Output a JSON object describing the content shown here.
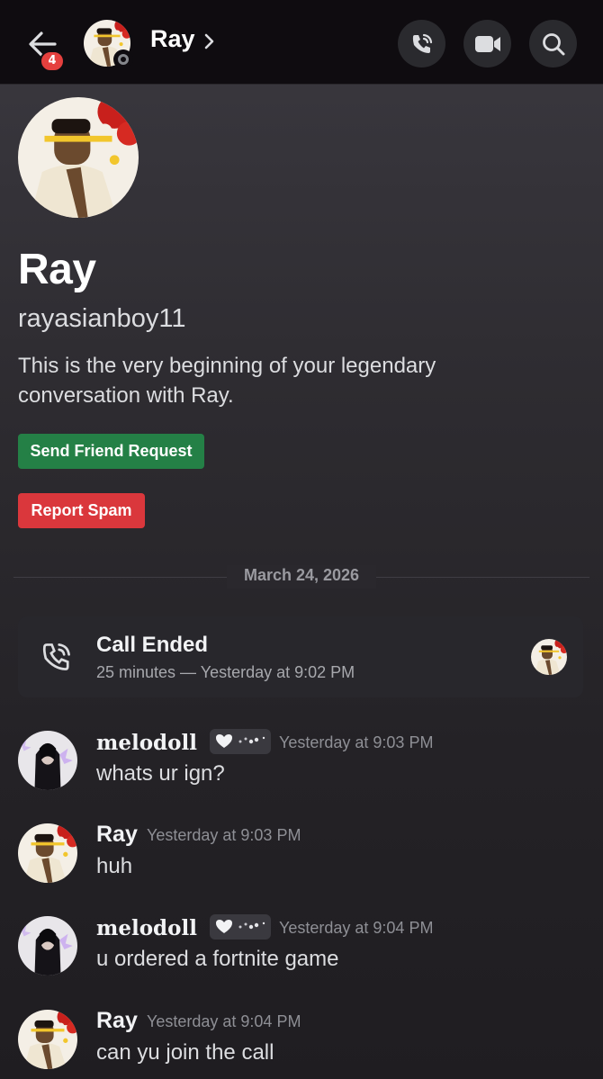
{
  "header": {
    "name": "Ray",
    "badge_count": "4",
    "icons": {
      "back": "arrow-left-icon",
      "chevron": "chevron-right-icon",
      "call": "phone-call-icon",
      "video": "video-camera-icon",
      "search": "search-icon"
    }
  },
  "profile": {
    "display_name": "Ray",
    "username": "rayasianboy11",
    "intro": "This is the very beginning of your legendary conversation with Ray.",
    "friend_button": "Send Friend Request",
    "spam_button": "Report Spam"
  },
  "divider_date": "March 24, 2026",
  "call": {
    "title": "Call Ended",
    "subtitle": "25 minutes — Yesterday at 9:02 PM"
  },
  "messages": [
    {
      "author": "melodoll",
      "time": "Yesterday at 9:03 PM",
      "text": "whats ur ign?"
    },
    {
      "author": "Ray",
      "time": "Yesterday at 9:03 PM",
      "text": "huh"
    },
    {
      "author": "melodoll",
      "time": "Yesterday at 9:04 PM",
      "text": "u ordered a fortnite game"
    },
    {
      "author": "Ray",
      "time": "Yesterday at 9:04 PM",
      "text": "can yu join the call"
    }
  ],
  "colors": {
    "header_bg": "#0f0c10",
    "green": "#248046",
    "red": "#da373c",
    "badge": "#e5403e"
  }
}
